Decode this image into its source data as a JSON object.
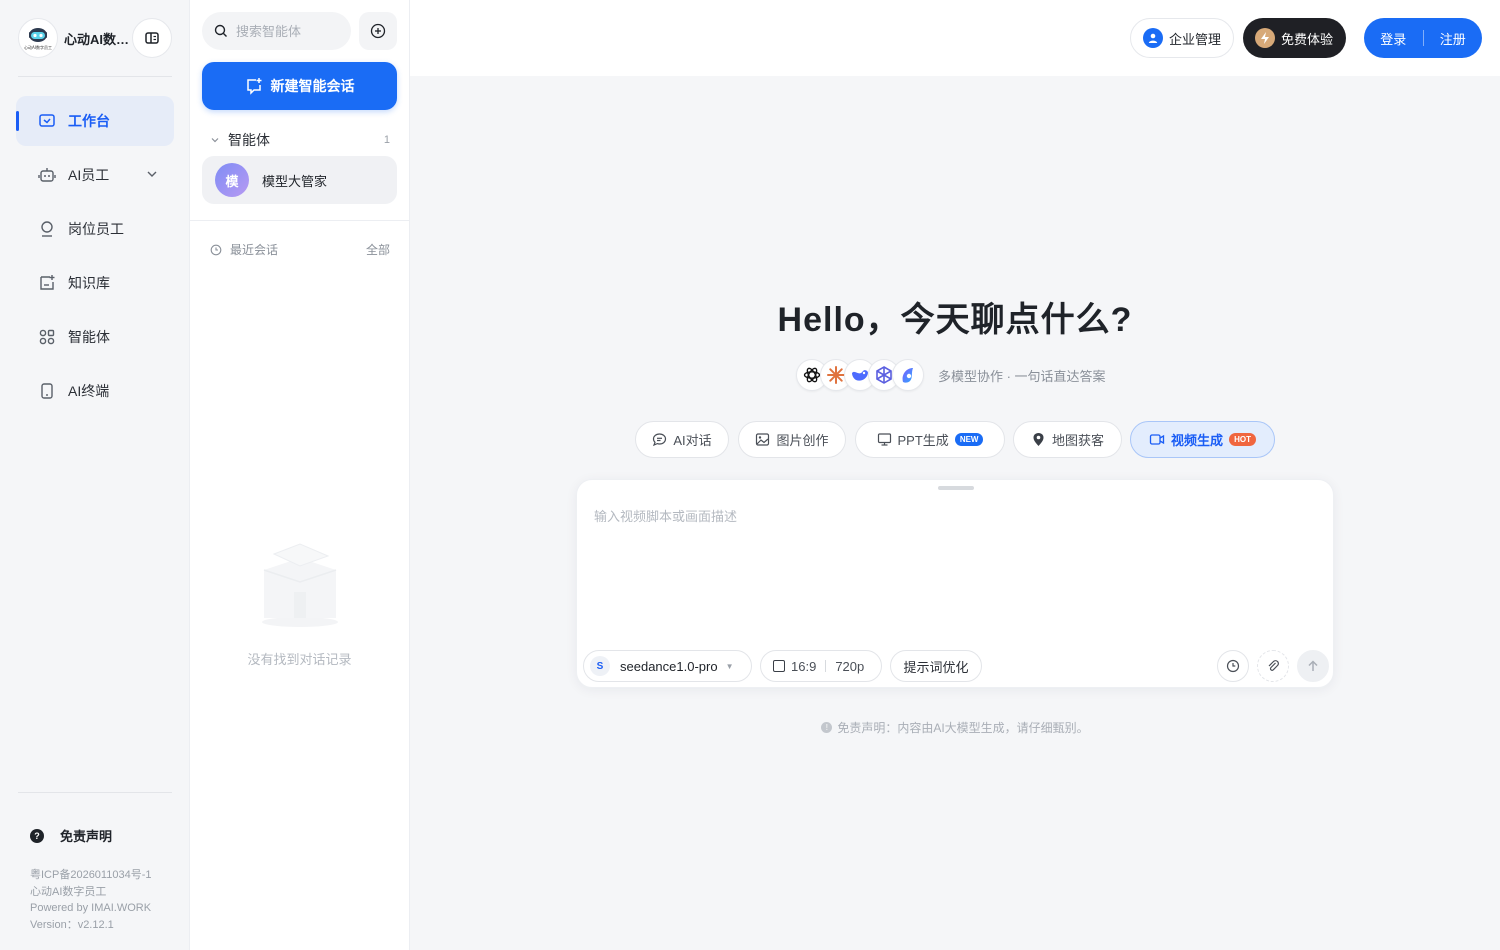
{
  "brand": {
    "name": "心动AI数字员工",
    "logo_caption": "心动AI数字员工"
  },
  "sidebar": {
    "items": [
      {
        "label": "工作台",
        "icon": "workbench-icon",
        "active": true
      },
      {
        "label": "AI员工",
        "icon": "robot-icon",
        "has_submenu": true
      },
      {
        "label": "岗位员工",
        "icon": "user-icon"
      },
      {
        "label": "知识库",
        "icon": "knowledge-icon"
      },
      {
        "label": "智能体",
        "icon": "apps-icon"
      },
      {
        "label": "AI终端",
        "icon": "phone-icon"
      }
    ],
    "disclaimer_label": "免责声明",
    "footer": {
      "icp": "粤ICP备2026011034号-1",
      "company": "心动AI数字员工",
      "powered": "Powered by IMAI.WORK",
      "version": "Version：v2.12.1"
    }
  },
  "agent_panel": {
    "search_placeholder": "搜索智能体",
    "new_chat_label": "新建智能会话",
    "agents_section": {
      "title": "智能体",
      "count": "1"
    },
    "agents": [
      {
        "avatar": "模",
        "name": "模型大管家"
      }
    ],
    "recent": {
      "title": "最近会话",
      "all_label": "全部"
    },
    "empty_text": "没有找到对话记录"
  },
  "header": {
    "enterprise_label": "企业管理",
    "trial_label": "免费体验",
    "login_label": "登录",
    "register_label": "注册"
  },
  "main": {
    "title": "Hello，今天聊点什么?",
    "models_caption": "多模型协作 · 一句话直达答案",
    "model_icons": [
      "openai-icon",
      "claude-icon",
      "deepseek-icon",
      "perplexity-icon",
      "kimi-icon"
    ],
    "tabs": [
      {
        "label": "AI对话",
        "icon": "chat-icon"
      },
      {
        "label": "图片创作",
        "icon": "image-icon"
      },
      {
        "label": "PPT生成",
        "icon": "monitor-icon",
        "badge": "NEW"
      },
      {
        "label": "地图获客",
        "icon": "map-pin-icon"
      },
      {
        "label": "视频生成",
        "icon": "video-icon",
        "badge": "HOT",
        "active": true
      }
    ],
    "composer": {
      "placeholder": "输入视频脚本或画面描述",
      "model_initial": "S",
      "model_name": "seedance1.0-pro",
      "ratio": "16:9",
      "resolution": "720p",
      "optimize_label": "提示词优化"
    },
    "disclaimer": "免责声明：内容由AI大模型生成，请仔细甄别。"
  },
  "colors": {
    "accent": "#1a6cf5",
    "hot": "#f0663f",
    "dark_button": "#1f2025"
  }
}
